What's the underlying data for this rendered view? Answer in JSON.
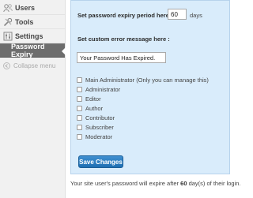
{
  "sidebar": {
    "items": [
      {
        "label": "Users",
        "icon": "users-icon"
      },
      {
        "label": "Tools",
        "icon": "tools-icon"
      },
      {
        "label": "Settings",
        "icon": "settings-icon"
      }
    ],
    "active_item": {
      "label": "Password Expiry"
    },
    "collapse": {
      "label": "Collapse menu"
    }
  },
  "form": {
    "period_label": "Set password expiry period here :",
    "period_value": "60",
    "period_unit": "days",
    "message_label": "Set custom error message here :",
    "message_value": "Your Password Has Expired.",
    "roles": [
      "Main Administrator (Only you can manage this)",
      "Administrator",
      "Editor",
      "Author",
      "Contributor",
      "Subscriber",
      "Moderator"
    ],
    "save_label": "Save Changes"
  },
  "footer": {
    "prefix": "Your site user's password will expire after",
    "days": "60",
    "suffix": "day(s) of their login."
  },
  "colors": {
    "panel_bg": "#d9ecfb",
    "button_bg": "#2b7fc2",
    "active_nav_bg": "#6d6d6d"
  }
}
